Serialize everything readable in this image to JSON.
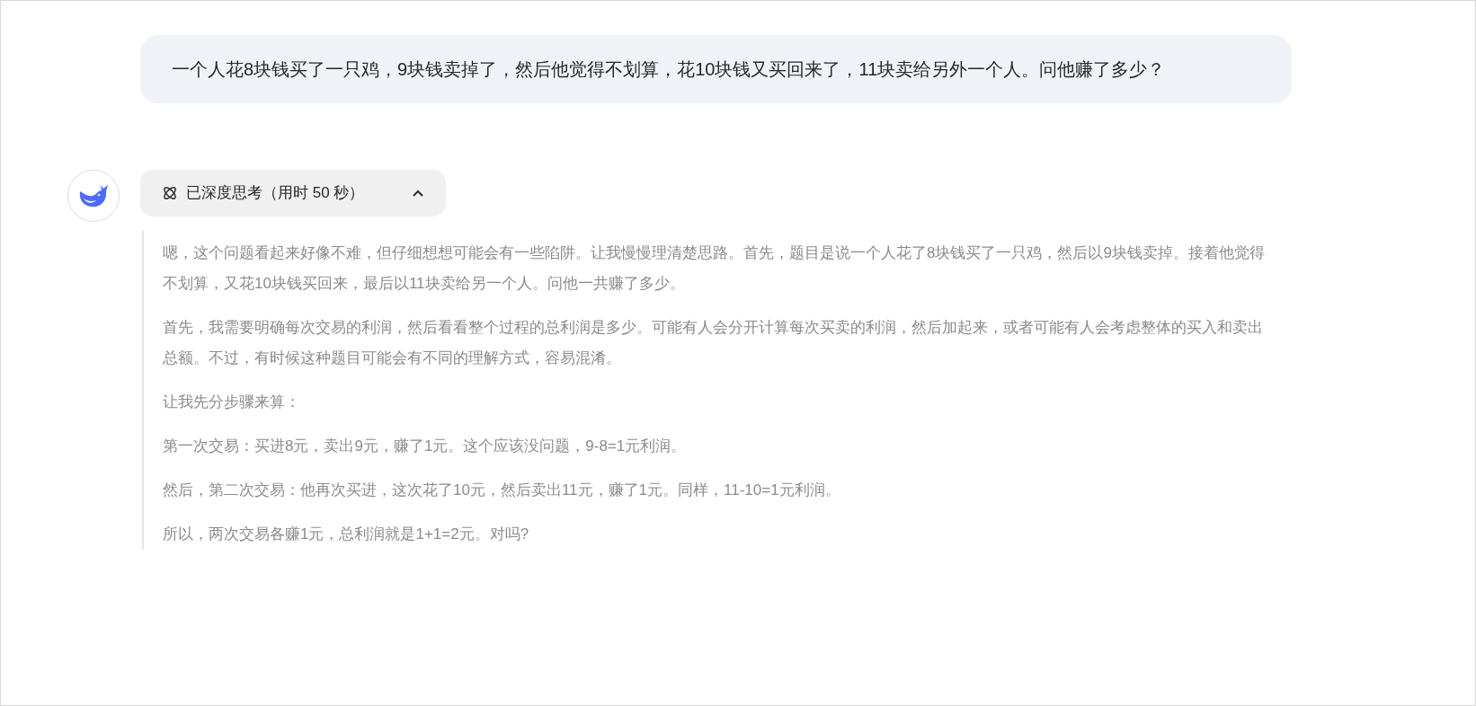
{
  "user_message": "一个人花8块钱买了一只鸡，9块钱卖掉了，然后他觉得不划算，花10块钱又买回来了，11块卖给另外一个人。问他赚了多少？",
  "thinking_toggle": {
    "label": "已深度思考（用时 50 秒）",
    "expanded": true
  },
  "thinking_paragraphs": [
    "嗯，这个问题看起来好像不难，但仔细想想可能会有一些陷阱。让我慢慢理清楚思路。首先，题目是说一个人花了8块钱买了一只鸡，然后以9块钱卖掉。接着他觉得不划算，又花10块钱买回来，最后以11块卖给另一个人。问他一共赚了多少。",
    "首先，我需要明确每次交易的利润，然后看看整个过程的总利润是多少。可能有人会分开计算每次买卖的利润，然后加起来，或者可能有人会考虑整体的买入和卖出总额。不过，有时候这种题目可能会有不同的理解方式，容易混淆。",
    "让我先分步骤来算：",
    "第一次交易：买进8元，卖出9元，赚了1元。这个应该没问题，9-8=1元利润。",
    "然后，第二次交易：他再次买进，这次花了10元，然后卖出11元，赚了1元。同样，11-10=1元利润。",
    "所以，两次交易各赚1元，总利润就是1+1=2元。对吗?"
  ]
}
